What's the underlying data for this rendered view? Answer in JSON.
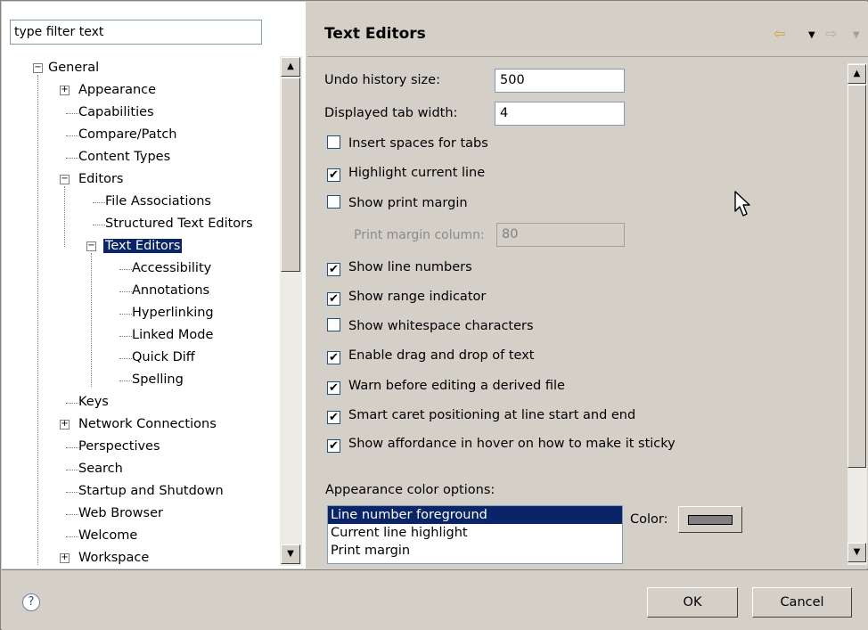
{
  "filter": {
    "placeholder": "type filter text",
    "value": "type filter text"
  },
  "tree": {
    "general": "General",
    "appearance": "Appearance",
    "capabilities": "Capabilities",
    "compare": "Compare/Patch",
    "content_types": "Content Types",
    "editors": "Editors",
    "file_assoc": "File Associations",
    "structured": "Structured Text Editors",
    "text_editors": "Text Editors",
    "accessibility": "Accessibility",
    "annotations": "Annotations",
    "hyperlinking": "Hyperlinking",
    "linked_mode": "Linked Mode",
    "quick_diff": "Quick Diff",
    "spelling": "Spelling",
    "keys": "Keys",
    "network": "Network Connections",
    "perspectives": "Perspectives",
    "search": "Search",
    "startup": "Startup and Shutdown",
    "web_browser": "Web Browser",
    "welcome": "Welcome",
    "workspace": "Workspace"
  },
  "header": {
    "title": "Text Editors"
  },
  "form": {
    "undo_label": "Undo history size:",
    "undo_value": "500",
    "tab_label": "Displayed tab width:",
    "tab_value": "4",
    "print_margin_label": "Print margin column:",
    "print_margin_value": "80",
    "appearance_label": "Appearance color options:",
    "color_label": "Color:"
  },
  "checkboxes": [
    {
      "label": "Insert spaces for tabs",
      "checked": false
    },
    {
      "label": "Highlight current line",
      "checked": true
    },
    {
      "label": "Show print margin",
      "checked": false
    },
    {
      "label": "Show line numbers",
      "checked": true
    },
    {
      "label": "Show range indicator",
      "checked": true
    },
    {
      "label": "Show whitespace characters",
      "checked": false
    },
    {
      "label": "Enable drag and drop of text",
      "checked": true
    },
    {
      "label": "Warn before editing a derived file",
      "checked": true
    },
    {
      "label": "Smart caret positioning at line start and end",
      "checked": true
    },
    {
      "label": "Show affordance in hover on how to make it sticky",
      "checked": true
    }
  ],
  "color_options": [
    "Line number foreground",
    "Current line highlight",
    "Print margin"
  ],
  "colors": {
    "selection": "#0a246a",
    "swatch": "#808080"
  },
  "buttons": {
    "ok": "OK",
    "cancel": "Cancel"
  }
}
